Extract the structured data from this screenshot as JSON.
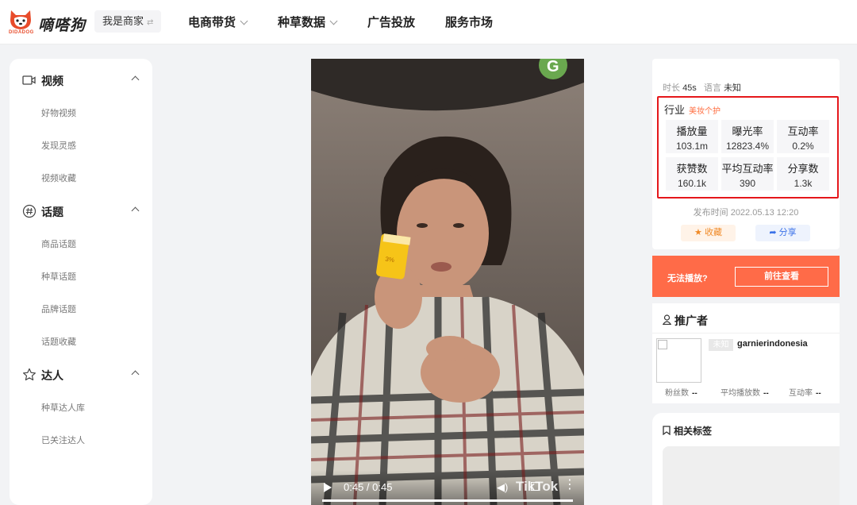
{
  "header": {
    "logo_text": "嘀嗒狗",
    "logo_sub": "DIDADOG",
    "merchant_label": "我是商家",
    "swap_icon": "⇄",
    "nav": [
      {
        "label": "电商带货",
        "has_dropdown": true
      },
      {
        "label": "种草数据",
        "has_dropdown": true
      },
      {
        "label": "广告投放",
        "has_dropdown": false
      },
      {
        "label": "服务市场",
        "has_dropdown": false
      }
    ]
  },
  "sidebar": {
    "sections": [
      {
        "label": "视频",
        "icon": "video-camera-icon",
        "items": [
          "好物视频",
          "发现灵感",
          "视频收藏"
        ]
      },
      {
        "label": "话题",
        "icon": "hashtag-icon",
        "items": [
          "商品话题",
          "种草话题",
          "品牌话题",
          "话题收藏"
        ]
      },
      {
        "label": "达人",
        "icon": "star-icon",
        "items": [
          "种草达人库",
          "已关注达人"
        ]
      }
    ]
  },
  "video": {
    "time": "0:45 / 0:45",
    "watermark": "TikTok",
    "progress": 1.0,
    "product_label": "3%"
  },
  "info": {
    "duration_label": "时长",
    "duration": "45s",
    "language_label": "语言",
    "language": "未知",
    "industry_label": "行业",
    "industry_tag": "美妆个护",
    "stats": [
      {
        "label": "播放量",
        "value": "103.1m"
      },
      {
        "label": "曝光率",
        "value": "12823.4%"
      },
      {
        "label": "互动率",
        "value": "0.2%"
      },
      {
        "label": "获赞数",
        "value": "160.1k"
      },
      {
        "label": "平均互动率",
        "value": "390"
      },
      {
        "label": "分享数",
        "value": "1.3k"
      }
    ],
    "publish_time": "发布时间 2022.05.13 12:20",
    "fav_label": "收藏",
    "share_label": "分享"
  },
  "banner": {
    "text": "无法播放?",
    "button": "前往查看"
  },
  "promoter": {
    "title": "推广者",
    "badge": "未知",
    "name": "garnierindonesia",
    "stats": [
      {
        "label": "粉丝数",
        "value": "--"
      },
      {
        "label": "平均播放数",
        "value": "--"
      },
      {
        "label": "互动率",
        "value": "--"
      }
    ]
  },
  "tags": {
    "title": "相关标签"
  },
  "colors": {
    "accent_red": "#e5171b",
    "banner_orange": "#ff6b48",
    "tag_orange": "#ff6b3d",
    "share_blue": "#3b72e8"
  }
}
